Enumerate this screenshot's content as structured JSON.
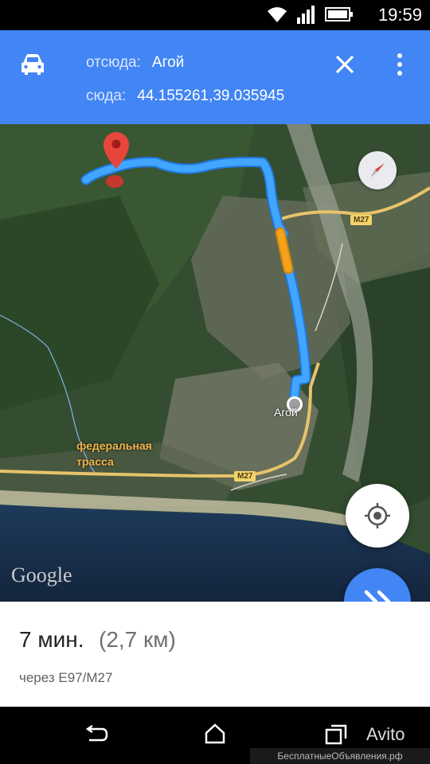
{
  "status": {
    "time": "19:59"
  },
  "route": {
    "from_label": "отсюда:",
    "from_value": "Агой",
    "to_label": "сюда:",
    "to_value": "44.155261,39.035945"
  },
  "map": {
    "town_label": "Агой",
    "road_label_1": "федеральная",
    "road_label_2": "трасса",
    "road_badge_1": "M27",
    "road_badge_2": "M27",
    "google_logo": "Google"
  },
  "summary": {
    "duration": "7 мин.",
    "distance": "(2,7 км)",
    "via": "через E97/M27"
  },
  "watermark": {
    "avito": "Avito",
    "site": "БесплатныеОбъявления.рф"
  },
  "colors": {
    "header": "#4285f4",
    "route": "#2196f3",
    "traffic": "#f4a21a",
    "pin": "#e8453c"
  }
}
